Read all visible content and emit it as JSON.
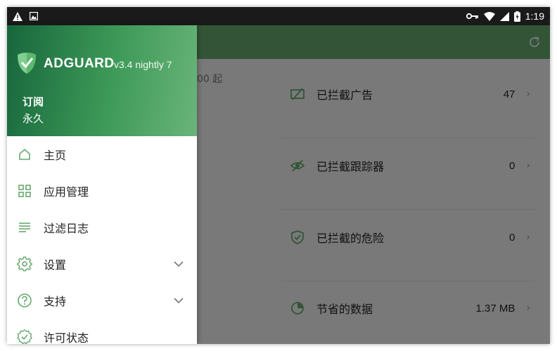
{
  "status_bar": {
    "left_icons": [
      "warning-icon",
      "photo-notification-icon"
    ],
    "right_icons": [
      "vpn-key-icon",
      "wifi-icon",
      "signal-icon",
      "battery-icon"
    ],
    "time": "1:19"
  },
  "drawer": {
    "brand": "ADGUARD",
    "version": "v3.4 nightly 7",
    "subscription_label": "订阅",
    "subscription_value": "永久",
    "items": [
      {
        "label": "主页",
        "icon": "home-icon",
        "expandable": false
      },
      {
        "label": "应用管理",
        "icon": "apps-grid-icon",
        "expandable": false
      },
      {
        "label": "过滤日志",
        "icon": "filter-log-icon",
        "expandable": false
      },
      {
        "label": "设置",
        "icon": "gear-icon",
        "expandable": true
      },
      {
        "label": "支持",
        "icon": "help-icon",
        "expandable": true
      },
      {
        "label": "许可状态",
        "icon": "license-icon",
        "expandable": false
      }
    ]
  },
  "main": {
    "partial_filter_text": "00 起",
    "stats": [
      {
        "label": "已拦截广告",
        "value": "47",
        "icon": "ad-block-icon"
      },
      {
        "label": "已拦截跟踪器",
        "value": "0",
        "icon": "tracker-block-icon"
      },
      {
        "label": "已拦截的危险",
        "value": "0",
        "icon": "shield-check-icon"
      },
      {
        "label": "节省的数据",
        "value": "1.37 MB",
        "icon": "pie-chart-icon"
      }
    ]
  },
  "colors": {
    "accent": "#67a86f",
    "header_dark": "#17663c",
    "status_bar": "#1a1a1a"
  }
}
